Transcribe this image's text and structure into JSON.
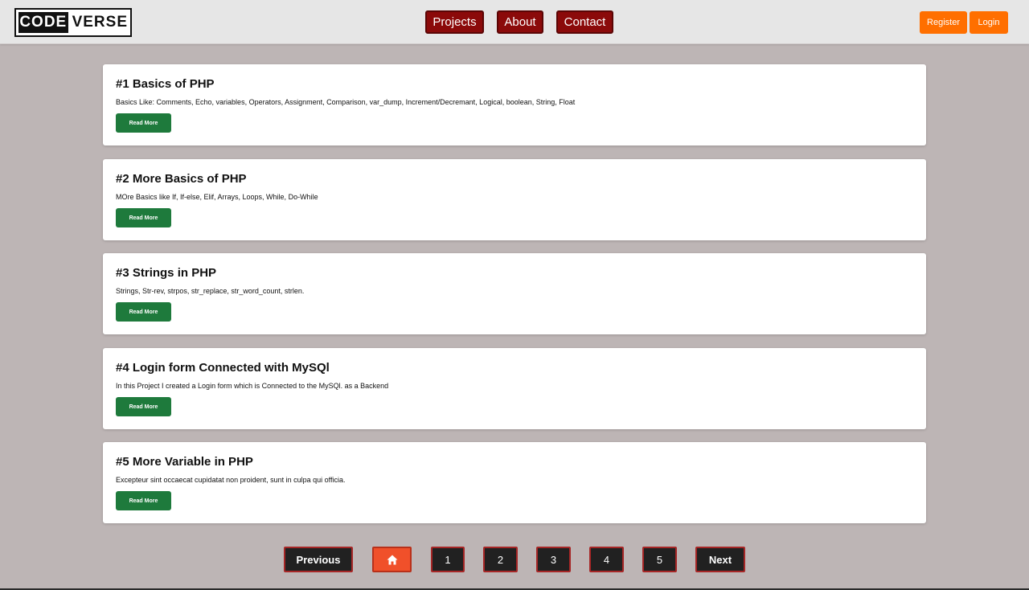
{
  "brand": {
    "left": "CODE",
    "right": "VERSE"
  },
  "nav": {
    "projects": "Projects",
    "about": "About",
    "contact": "Contact"
  },
  "auth": {
    "register": "Register",
    "login": "Login"
  },
  "posts": [
    {
      "title": "#1 Basics of PHP",
      "desc": "Basics Like: Comments, Echo, variables, Operators, Assignment, Comparison, var_dump, Increment/Decremant, Logical, boolean, String, Float",
      "button": "Read More"
    },
    {
      "title": "#2 More Basics of PHP",
      "desc": "MOre Basics like If, If-else, Elif, Arrays, Loops, While, Do-While",
      "button": "Read More"
    },
    {
      "title": "#3 Strings in PHP",
      "desc": "Strings, Str-rev, strpos, str_replace, str_word_count, strlen.",
      "button": "Read More"
    },
    {
      "title": "#4 Login form Connected with MySQl",
      "desc": "In this Project I created a Login form which is Connected to the MySQl. as a Backend",
      "button": "Read More"
    },
    {
      "title": "#5 More Variable in PHP",
      "desc": "Excepteur sint occaecat cupidatat non proident, sunt in culpa qui officia.",
      "button": "Read More"
    }
  ],
  "pagination": {
    "previous": "Previous",
    "home_icon": "home-icon",
    "pages": [
      "1",
      "2",
      "3",
      "4",
      "5"
    ],
    "next": "Next"
  },
  "colors": {
    "background": "#bdb5b5",
    "nav_button": "#8b0a0a",
    "auth_button": "#ff6f00",
    "read_more": "#1e7a3c",
    "pagination_bg": "#212121",
    "pagination_border": "#a62626",
    "home_button": "#f0502a"
  }
}
